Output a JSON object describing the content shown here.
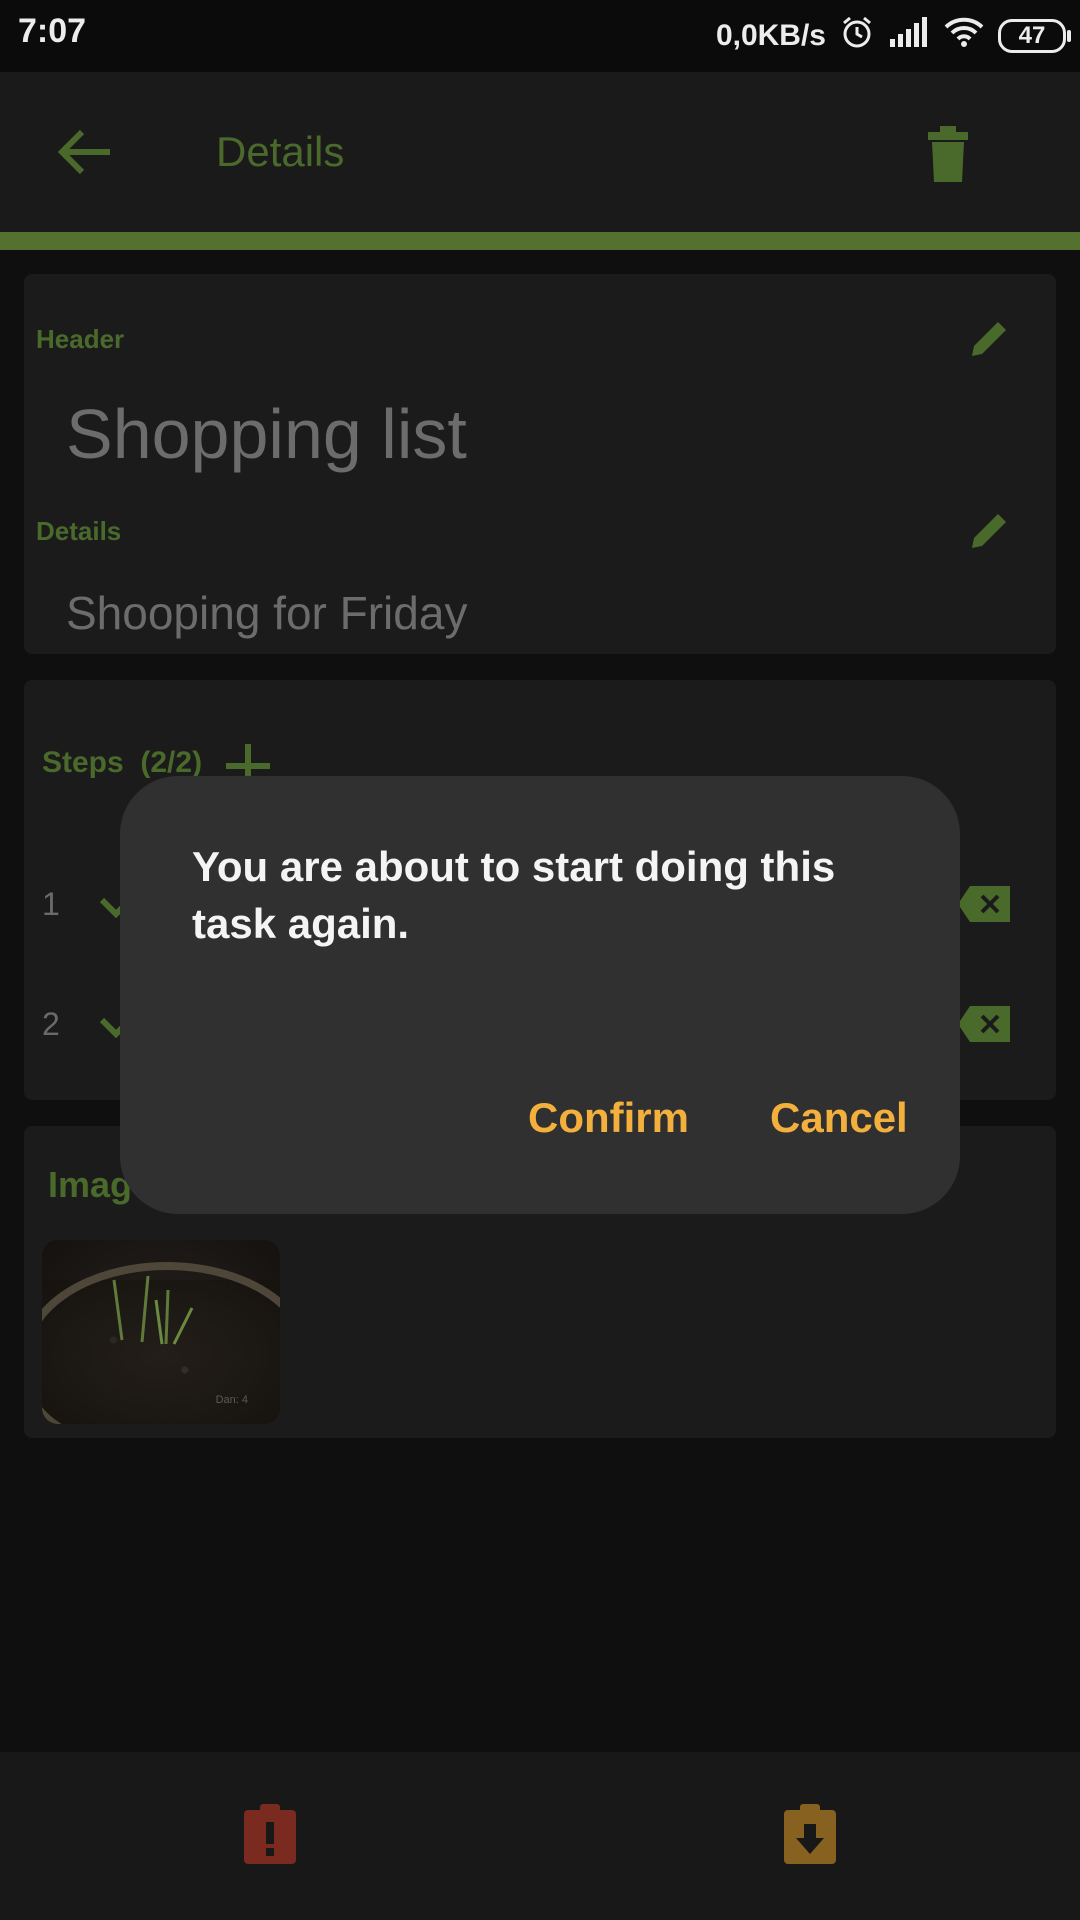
{
  "status_bar": {
    "time": "7:07",
    "network_speed": "0,0KB/s",
    "battery": "47"
  },
  "app_bar": {
    "title": "Details"
  },
  "task": {
    "header_label": "Header",
    "header_value": "Shopping list",
    "details_label": "Details",
    "details_value": "Shooping for Friday"
  },
  "steps": {
    "label": "Steps",
    "count": "(2/2)",
    "items": [
      {
        "number": "1"
      },
      {
        "number": "2"
      }
    ]
  },
  "images": {
    "label": "Imag",
    "thumb_caption": "Dan: 4"
  },
  "dialog": {
    "message": "You are about to start doing this task again.",
    "confirm_label": "Confirm",
    "cancel_label": "Cancel"
  },
  "colors": {
    "accent_green": "#55712f",
    "dialog_button": "#f3b03c",
    "dialog_bg": "#303030",
    "alert_red": "#7a2a1e",
    "save_orange": "#86611f"
  }
}
